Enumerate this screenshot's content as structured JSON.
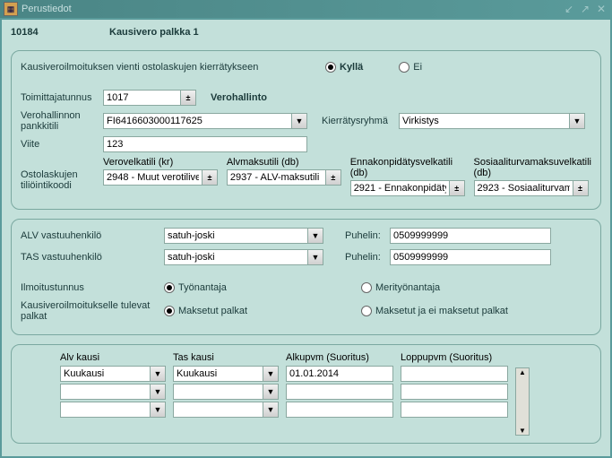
{
  "title": "Perustiedot",
  "header": {
    "code": "10184",
    "name": "Kausivero palkka 1"
  },
  "p1": {
    "exportLabel": "Kausiveroilmoituksen vienti ostolaskujen kierrätykseen",
    "yes": "Kyllä",
    "no": "Ei",
    "exportSel": "yes",
    "supplierLabel": "Toimittajatunnus",
    "supplier": "1017",
    "supplierName": "Verohallinto",
    "bankLabel": "Verohallinnon pankkitili",
    "bank": "FI6416603000117625",
    "groupLabel": "Kierrätysryhmä",
    "group": "Virkistys",
    "refLabel": "Viite",
    "ref": "123",
    "acctLabel": "Ostolaskujen tiliöintikoodi",
    "acct1Label": "Verovelkatili (kr)",
    "acct1": "2948 - Muut verotilive",
    "acct2Label": "Alvmaksutili (db)",
    "acct2": "2937 - ALV-maksutili",
    "acct3Label": "Ennakonpidätysvelkatili (db)",
    "acct3": "2921 - Ennakonpidäty",
    "acct4Label": "Sosiaaliturvamaksuvelkatili (db)",
    "acct4": "2923 - Sosiaaliturvam"
  },
  "p2": {
    "alvRespLabel": "ALV vastuuhenkilö",
    "alvResp": "satuh-joski",
    "phoneLabel": "Puhelin:",
    "alvPhone": "0509999999",
    "tasRespLabel": "TAS vastuuhenkilö",
    "tasResp": "satuh-joski",
    "tasPhone": "0509999999",
    "notifLabel": "Ilmoitustunnus",
    "notifOpt1": "Työnantaja",
    "notifOpt2": "Merityönantaja",
    "notifSel": "1",
    "salaryLabel": "Kausiveroilmoitukselle tulevat palkat",
    "salaryOpt1": "Maksetut palkat",
    "salaryOpt2": "Maksetut ja ei maksetut palkat",
    "salarySel": "1"
  },
  "p3": {
    "alvKausiHdr": "Alv kausi",
    "tasKausiHdr": "Tas kausi",
    "alkuHdr": "Alkupvm (Suoritus)",
    "loppuHdr": "Loppupvm (Suoritus)",
    "rows": [
      {
        "alv": "Kuukausi",
        "tas": "Kuukausi",
        "alku": "01.01.2014",
        "loppu": ""
      },
      {
        "alv": "",
        "tas": "",
        "alku": "",
        "loppu": ""
      },
      {
        "alv": "",
        "tas": "",
        "alku": "",
        "loppu": ""
      }
    ]
  }
}
